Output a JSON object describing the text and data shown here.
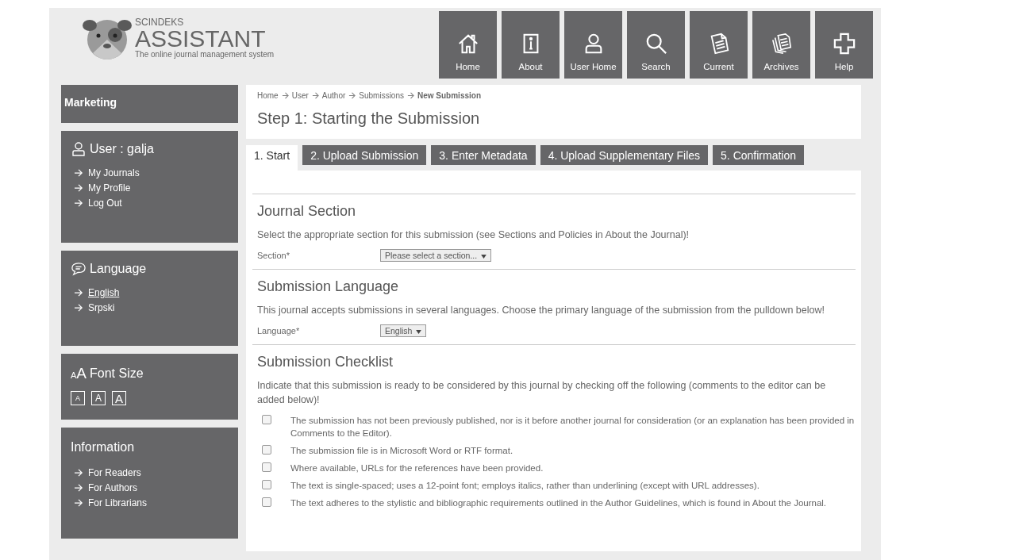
{
  "header": {
    "brand_small": "SCINDEKS",
    "brand": "ASSISTANT",
    "tagline": "The online journal management system",
    "nav": [
      {
        "label": "Home"
      },
      {
        "label": "About"
      },
      {
        "label": "User Home"
      },
      {
        "label": "Search"
      },
      {
        "label": "Current"
      },
      {
        "label": "Archives"
      },
      {
        "label": "Help"
      }
    ]
  },
  "sidebar": [
    {
      "kind": "title",
      "title": "Marketing"
    },
    {
      "kind": "user",
      "title": "User : galja",
      "links": [
        {
          "label": "My Journals",
          "selected": false
        },
        {
          "label": "My Profile",
          "selected": false
        },
        {
          "label": "Log Out",
          "selected": false
        }
      ]
    },
    {
      "kind": "language",
      "title": "Language",
      "links": [
        {
          "label": "English",
          "selected": true
        },
        {
          "label": "Srpski",
          "selected": false
        }
      ]
    },
    {
      "kind": "fontsize",
      "title": "Font Size",
      "icon_letters": [
        "A",
        "A"
      ],
      "sizes": [
        "A",
        "A",
        "A"
      ]
    },
    {
      "kind": "info",
      "title": "Information",
      "links": [
        {
          "label": "For Readers",
          "selected": false
        },
        {
          "label": "For Authors",
          "selected": false
        },
        {
          "label": "For Librarians",
          "selected": false
        }
      ]
    }
  ],
  "breadcrumb": [
    {
      "label": "Home"
    },
    {
      "label": "User"
    },
    {
      "label": "Author"
    },
    {
      "label": "Submissions"
    },
    {
      "label": "New Submission",
      "current": true
    }
  ],
  "page_title": "Step 1: Starting the Submission",
  "tabs": [
    {
      "label": "1. Start",
      "selected": true
    },
    {
      "label": "2. Upload Submission",
      "selected": false
    },
    {
      "label": "3. Enter Metadata",
      "selected": false
    },
    {
      "label": "4. Upload Supplementary Files",
      "selected": false
    },
    {
      "label": "5. Confirmation",
      "selected": false
    }
  ],
  "sections": [
    {
      "heading": "Journal Section",
      "text": "Select the appropriate section for this submission (see Sections and Policies in About the Journal)!",
      "field": {
        "label": "Section*",
        "value": "Please select a section..."
      }
    },
    {
      "heading": "Submission Language",
      "text": "This journal accepts submissions in several languages. Choose the primary language of the submission from the pulldown below!",
      "field": {
        "label": "Language*",
        "value": "English"
      }
    },
    {
      "heading": "Submission Checklist",
      "text": "Indicate that this submission is ready to be considered by this journal by checking off the following (comments to the editor can be added below)!",
      "checklist": [
        {
          "text": "The submission has not been previously published, nor is it before another journal for consideration (or an explanation has been provided in Comments to the Editor).",
          "checked": false
        },
        {
          "text": "The submission file is in Microsoft Word or RTF format.",
          "checked": false
        },
        {
          "text": "Where available, URLs for the references have been provided.",
          "checked": false
        },
        {
          "text": "The text is single-spaced; uses a 12-point font; employs italics, rather than underlining (except with URL addresses).",
          "checked": false
        },
        {
          "text": "The text adheres to the stylistic and bibliographic requirements outlined in the Author Guidelines, which is found in About the Journal.",
          "checked": false
        }
      ]
    }
  ]
}
